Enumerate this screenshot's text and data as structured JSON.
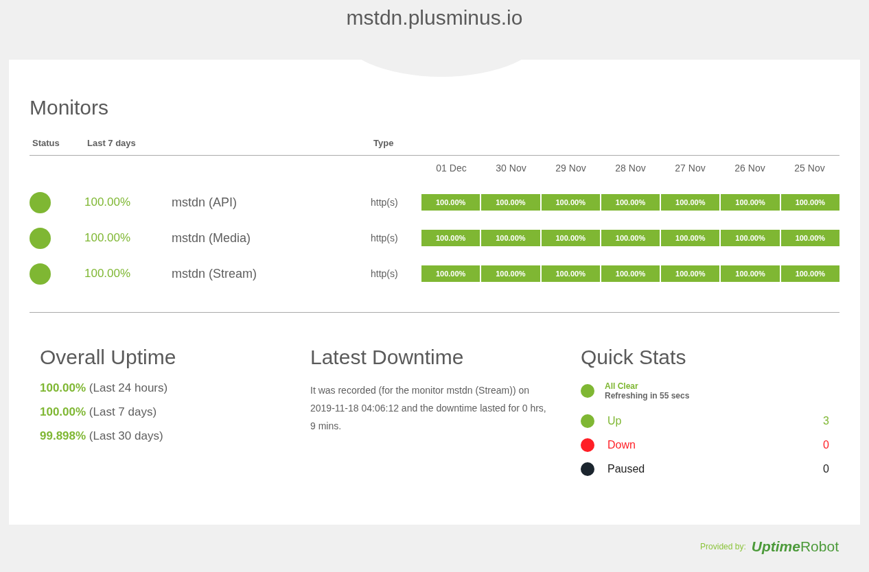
{
  "site_title": "mstdn.plusminus.io",
  "monitors": {
    "title": "Monitors",
    "columns": [
      "Status",
      "Last 7 days",
      "Type"
    ],
    "days": [
      "01 Dec",
      "30 Nov",
      "29 Nov",
      "28 Nov",
      "27 Nov",
      "26 Nov",
      "25 Nov"
    ],
    "rows": [
      {
        "color": "#7fb733",
        "uptime": "100.00%",
        "name": "mstdn (API)",
        "type": "http(s)",
        "daily": [
          {
            "text": "100.00%",
            "color": "#7fb733"
          },
          {
            "text": "100.00%",
            "color": "#7fb733"
          },
          {
            "text": "100.00%",
            "color": "#7fb733"
          },
          {
            "text": "100.00%",
            "color": "#7fb733"
          },
          {
            "text": "100.00%",
            "color": "#7fb733"
          },
          {
            "text": "100.00%",
            "color": "#7fb733"
          },
          {
            "text": "100.00%",
            "color": "#7fb733"
          }
        ]
      },
      {
        "color": "#7fb733",
        "uptime": "100.00%",
        "name": "mstdn (Media)",
        "type": "http(s)",
        "daily": [
          {
            "text": "100.00%",
            "color": "#7fb733"
          },
          {
            "text": "100.00%",
            "color": "#7fb733"
          },
          {
            "text": "100.00%",
            "color": "#7fb733"
          },
          {
            "text": "100.00%",
            "color": "#7fb733"
          },
          {
            "text": "100.00%",
            "color": "#7fb733"
          },
          {
            "text": "100.00%",
            "color": "#7fb733"
          },
          {
            "text": "100.00%",
            "color": "#7fb733"
          }
        ]
      },
      {
        "color": "#7fb733",
        "uptime": "100.00%",
        "name": "mstdn (Stream)",
        "type": "http(s)",
        "daily": [
          {
            "text": "100.00%",
            "color": "#7fb733"
          },
          {
            "text": "100.00%",
            "color": "#7fb733"
          },
          {
            "text": "100.00%",
            "color": "#7fb733"
          },
          {
            "text": "100.00%",
            "color": "#7fb733"
          },
          {
            "text": "100.00%",
            "color": "#7fb733"
          },
          {
            "text": "100.00%",
            "color": "#7fb733"
          },
          {
            "text": "100.00%",
            "color": "#7fb733"
          }
        ]
      }
    ]
  },
  "overall_uptime": {
    "title": "Overall Uptime",
    "items": [
      {
        "value": "100.00%",
        "period": "(Last 24 hours)"
      },
      {
        "value": "100.00%",
        "period": "(Last 7 days)"
      },
      {
        "value": "99.898%",
        "period": "(Last 30 days)"
      }
    ]
  },
  "latest_downtime": {
    "title": "Latest Downtime",
    "text": "It was recorded (for the monitor mstdn (Stream)) on 2019-11-18 04:06:12 and the downtime lasted for 0 hrs, 9 mins."
  },
  "quick_stats": {
    "title": "Quick Stats",
    "summary": {
      "status": "All Clear",
      "detail": "Refreshing in 55 secs",
      "color": "#7fb733"
    },
    "items": [
      {
        "label": "Up",
        "count": "3",
        "color": "#7fb733"
      },
      {
        "label": "Down",
        "count": "0",
        "color": "#ff1f26"
      },
      {
        "label": "Paused",
        "count": "0",
        "color": "#1b252e"
      }
    ]
  },
  "footer": {
    "provided_by": "Provided by:",
    "logo_bold": "Uptime",
    "logo_plain": "Robot"
  }
}
